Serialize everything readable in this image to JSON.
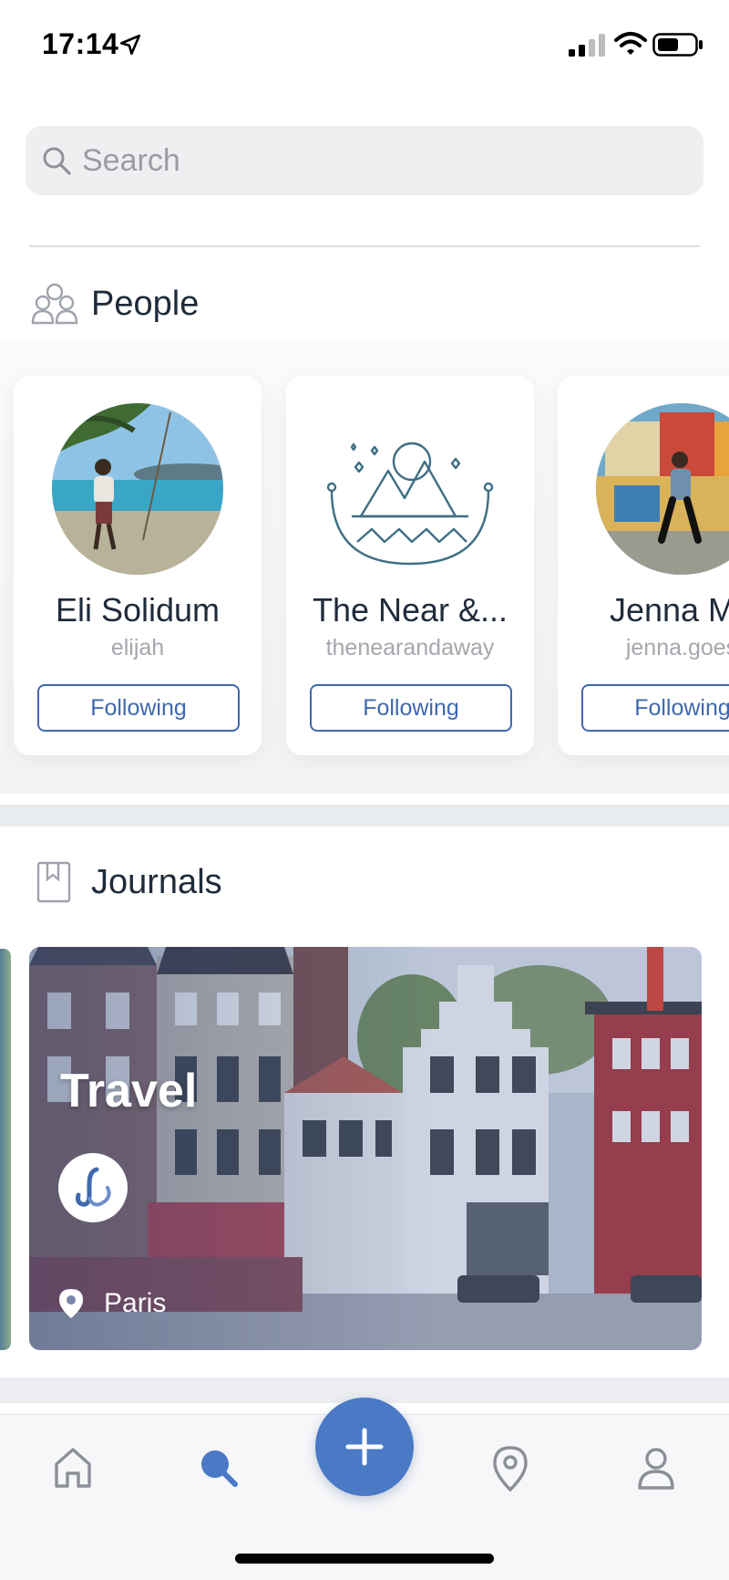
{
  "status_bar": {
    "time": "17:14"
  },
  "search": {
    "placeholder": "Search"
  },
  "sections": {
    "people": {
      "label": "People",
      "icon": "people-icon"
    },
    "journals": {
      "label": "Journals",
      "icon": "journal-icon"
    }
  },
  "people": [
    {
      "name": "Eli Solidum",
      "handle": "elijah",
      "button": "Following"
    },
    {
      "name": "The Near &...",
      "handle": "thenearandaway",
      "button": "Following"
    },
    {
      "name": "Jenna Ma",
      "handle": "jenna.goes",
      "button": "Following"
    }
  ],
  "journal": {
    "title": "Travel",
    "location": "Paris"
  },
  "tab_bar": {
    "items": [
      "home-icon",
      "search-icon",
      "add-icon",
      "location-icon",
      "profile-icon"
    ],
    "active": "search-icon"
  },
  "colors": {
    "accent": "#4a79c6",
    "button_outline": "#3f69ae",
    "text": "#1f2b3a",
    "muted": "#a4a7ad"
  }
}
